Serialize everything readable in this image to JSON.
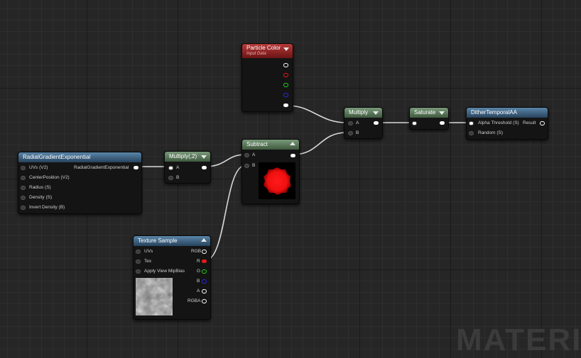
{
  "watermark": "MATERIA",
  "nodes": {
    "particle_color": {
      "title": "Particle Color",
      "subtitle": "Input Data"
    },
    "multiply": {
      "title": "Multiply",
      "pins": [
        "A",
        "B"
      ]
    },
    "saturate": {
      "title": "Saturate"
    },
    "dither": {
      "title": "DitherTemporalAA",
      "pins": [
        "Alpha Threshold (S)",
        "Random (S)"
      ],
      "output": "Result"
    },
    "radial": {
      "title": "RadialGradientExponential",
      "pins": [
        "UVs (V2)",
        "CenterPosition (V2)",
        "Radius (S)",
        "Density (S)",
        "Invert Density (B)"
      ],
      "output": "RadialGradientExponential"
    },
    "multiply2": {
      "title": "Multiply(,2)",
      "pins": [
        "A",
        "B"
      ]
    },
    "subtract": {
      "title": "Subtract",
      "pins": [
        "A",
        "B"
      ]
    },
    "texture": {
      "title": "Texture Sample",
      "pins": [
        "UVs",
        "Tex",
        "Apply View MipBias"
      ],
      "outputs": [
        "RGB",
        "R",
        "G",
        "B",
        "A",
        "RGBA"
      ]
    }
  },
  "colors": {
    "red": "#e81818",
    "green": "#1fd31f",
    "blue": "#2a2ae0",
    "white": "#ffffff"
  }
}
